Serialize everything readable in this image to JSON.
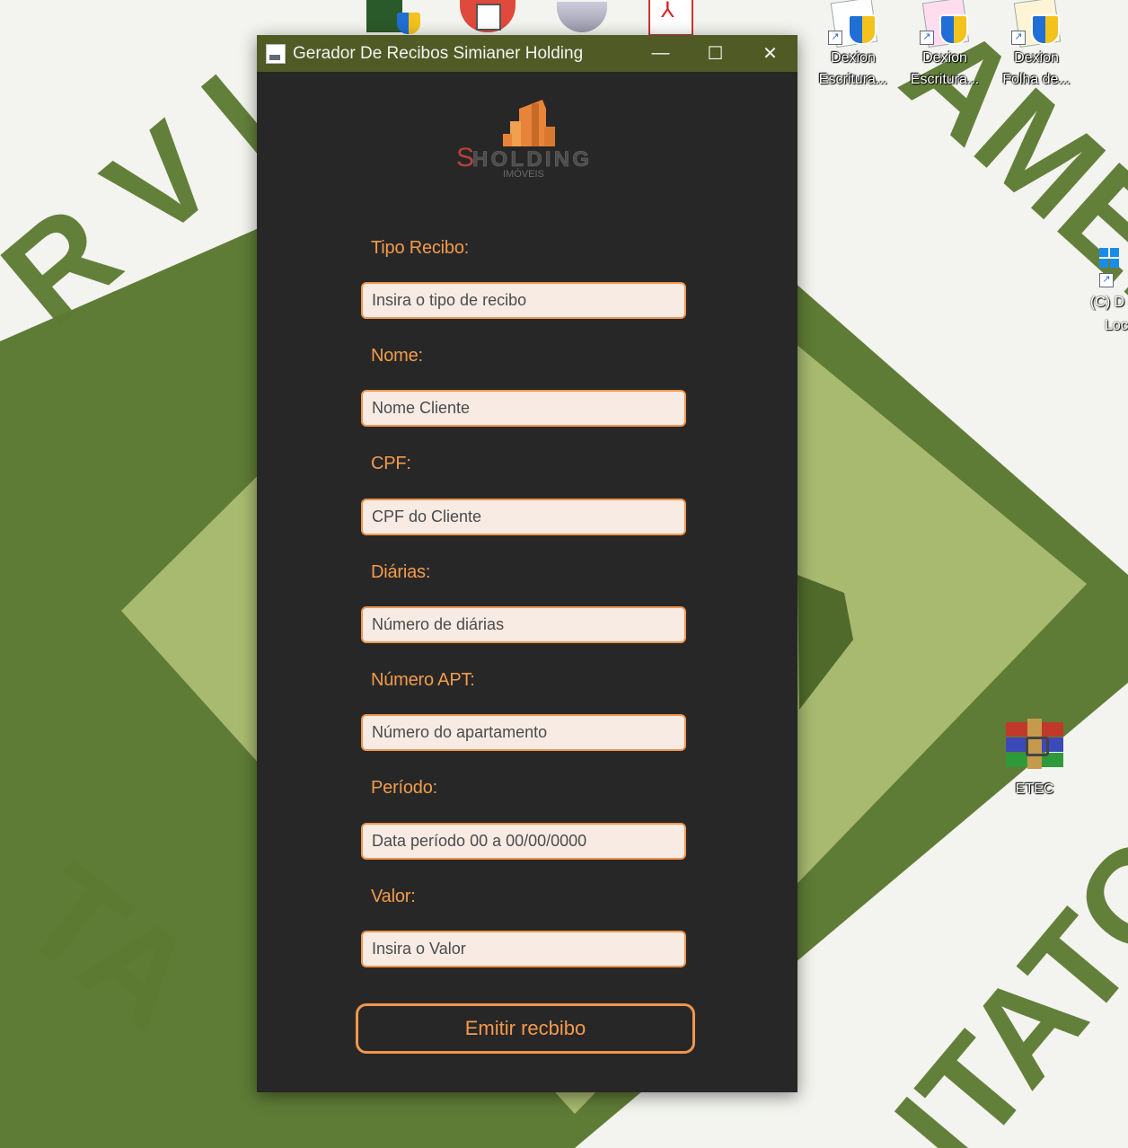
{
  "window": {
    "title": "Gerador De Recibos Simianer Holding",
    "minimize_symbol": "—",
    "maximize_symbol": "☐",
    "close_symbol": "✕"
  },
  "logo": {
    "brand": "HOLDING",
    "initial": "S",
    "subtitle": "IMÓVEIS"
  },
  "form": {
    "fields": [
      {
        "label": "Tipo Recibo:",
        "placeholder": "Insira o tipo de recibo"
      },
      {
        "label": "Nome:",
        "placeholder": "Nome Cliente"
      },
      {
        "label": "CPF:",
        "placeholder": "CPF do Cliente"
      },
      {
        "label": "Diárias:",
        "placeholder": "Número de diárias"
      },
      {
        "label": "Número APT:",
        "placeholder": "Número do apartamento"
      },
      {
        "label": "Período:",
        "placeholder": "Data período 00 a 00/00/0000"
      },
      {
        "label": "Valor:",
        "placeholder": "Insira o Valor"
      }
    ],
    "submit_label": "Emitir recbibo"
  },
  "desktop": {
    "icons": [
      {
        "caption_1": "Dexion",
        "caption_2": "Escritura...",
        "icon": "shield-shortcut-icon"
      },
      {
        "caption_1": "Dexion",
        "caption_2": "Escritura...",
        "icon": "shield-shortcut-icon"
      },
      {
        "caption_1": "Dexion",
        "caption_2": "Folha de...",
        "icon": "shield-shortcut-icon"
      },
      {
        "caption_1": "ETEC",
        "icon": "winrar-archive-icon"
      }
    ],
    "partial_icon_caption_1": "(C) D",
    "partial_icon_caption_2": "Loc"
  },
  "colors": {
    "window_bg": "#272727",
    "title_bar": "#4f5a25",
    "accent_orange": "#f29c4c",
    "input_bg": "#f7ebe4",
    "wallpaper_green_dark": "#5c7a32",
    "wallpaper_green_light": "#a9bb72"
  }
}
